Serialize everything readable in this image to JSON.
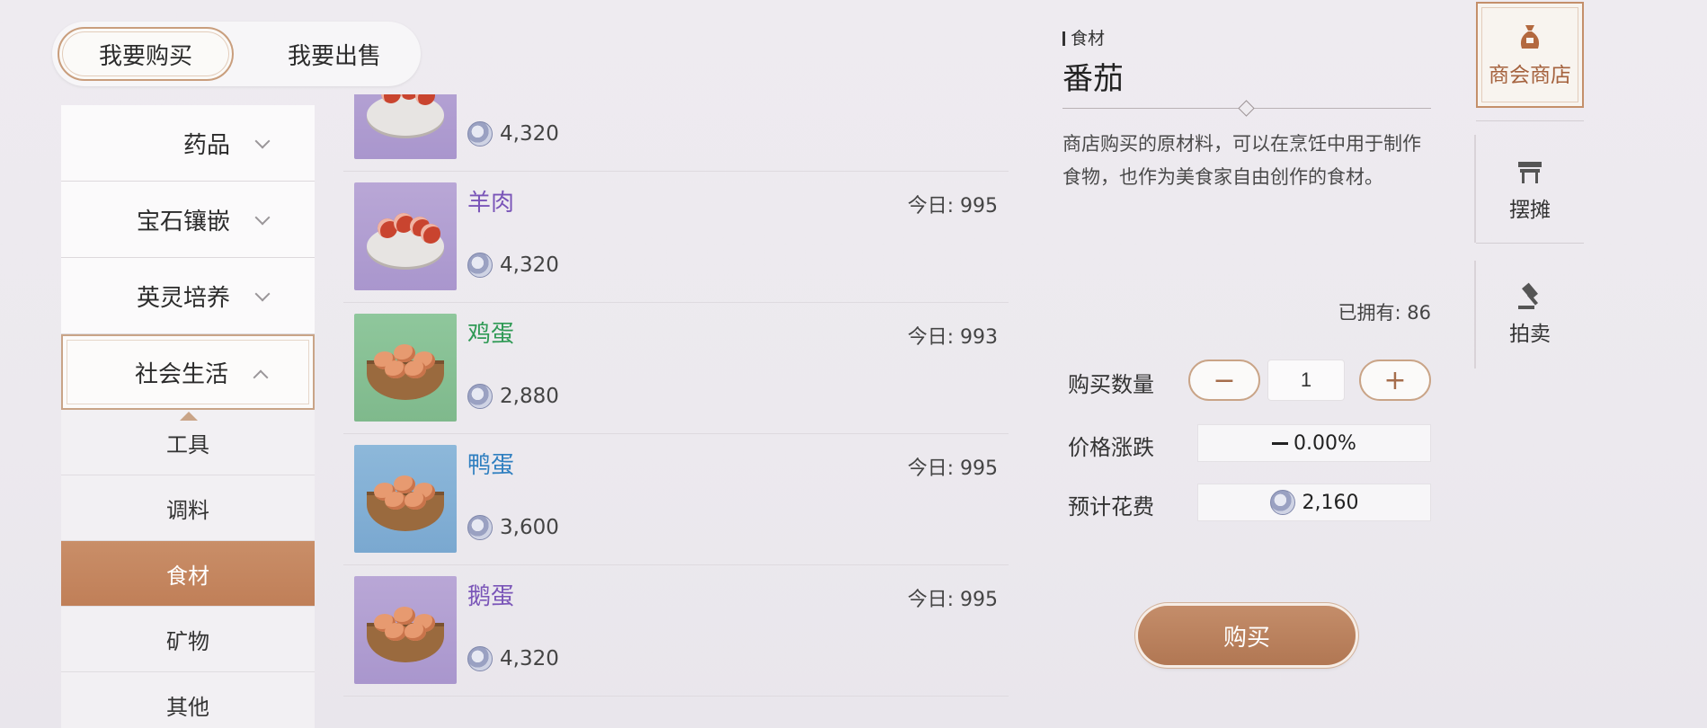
{
  "mode_toggle": {
    "buy": "我要购买",
    "sell": "我要出售"
  },
  "categories": [
    {
      "label": "药品",
      "open": false
    },
    {
      "label": "宝石镶嵌",
      "open": false
    },
    {
      "label": "英灵培养",
      "open": false
    },
    {
      "label": "社会生活",
      "open": true
    }
  ],
  "subcategories": [
    {
      "label": "工具",
      "active": false
    },
    {
      "label": "调料",
      "active": false
    },
    {
      "label": "食材",
      "active": true
    },
    {
      "label": "矿物",
      "active": false
    },
    {
      "label": "其他",
      "active": false
    }
  ],
  "items": [
    {
      "name": "",
      "today": "",
      "price": "4,320",
      "name_color": "#7a55b8",
      "thumb": "purple",
      "icon": "meat-icon"
    },
    {
      "name": "羊肉",
      "today": "今日: 995",
      "price": "4,320",
      "name_color": "#7a55b8",
      "thumb": "purple",
      "icon": "mutton-icon"
    },
    {
      "name": "鸡蛋",
      "today": "今日: 993",
      "price": "2,880",
      "name_color": "#2f9a55",
      "thumb": "green",
      "icon": "egg-basket-icon"
    },
    {
      "name": "鸭蛋",
      "today": "今日: 995",
      "price": "3,600",
      "name_color": "#2f7fc0",
      "thumb": "blue",
      "icon": "egg-basket-icon"
    },
    {
      "name": "鹅蛋",
      "today": "今日: 995",
      "price": "4,320",
      "name_color": "#7a55b8",
      "thumb": "purple",
      "icon": "egg-basket-icon"
    }
  ],
  "detail": {
    "category": "食材",
    "title": "番茄",
    "description": "商店购买的原材料，可以在烹饪中用于制作食物，也作为美食家自由创作的食材。",
    "owned": "已拥有: 86",
    "qty_label": "购买数量",
    "qty_value": "1",
    "minus": "−",
    "plus": "+",
    "change_label": "价格涨跌",
    "change_value": "0.00%",
    "cost_label": "预计花费",
    "cost_value": "2,160",
    "buy_button": "购买"
  },
  "side_tabs": [
    {
      "label": "商会商店",
      "active": true,
      "icon": "money-bag-icon"
    },
    {
      "label": "摆摊",
      "active": false,
      "icon": "stall-icon"
    },
    {
      "label": "拍卖",
      "active": false,
      "icon": "gavel-icon"
    }
  ],
  "colors": {
    "accent": "#c07f58",
    "accent_border": "#c9a487",
    "background": "#eeebf0"
  }
}
